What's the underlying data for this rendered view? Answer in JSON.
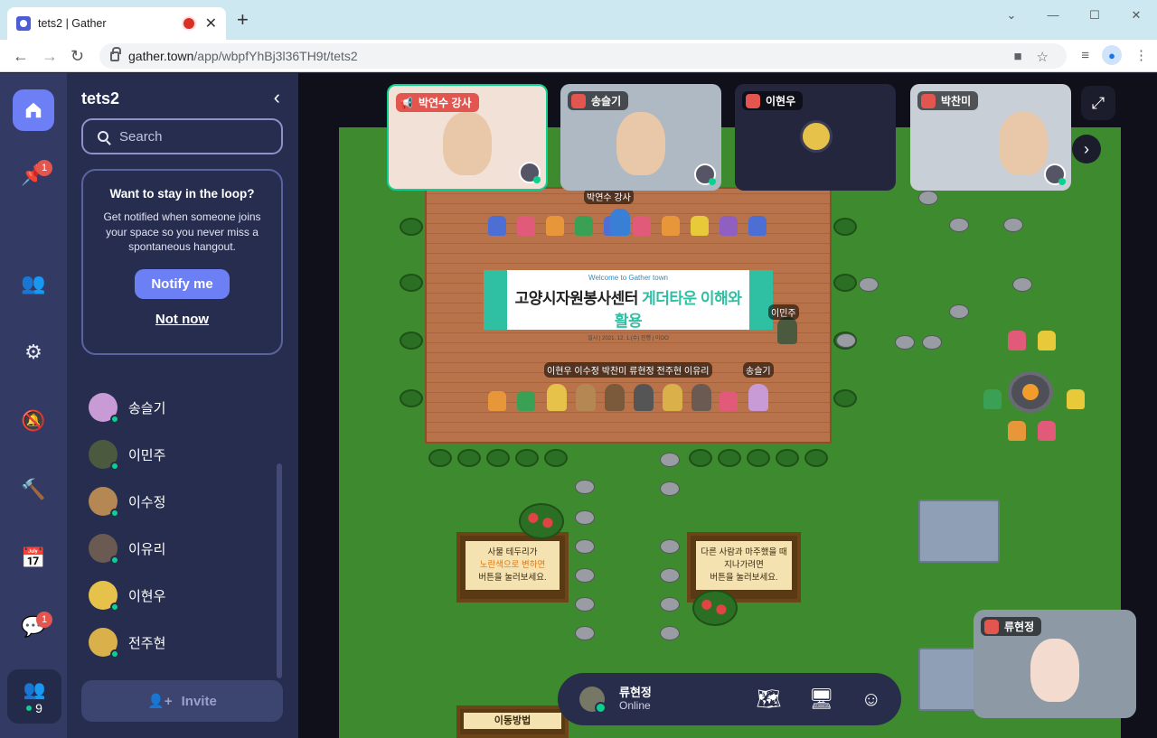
{
  "browser": {
    "tab_title": "tets2 | Gather",
    "tab_close": "✕",
    "new_tab": "+",
    "url_domain": "gather.town",
    "url_path": "/app/wbpfYhBj3l36TH9t/tets2"
  },
  "rail": {
    "notifications_badge": "1",
    "chat_badge": "1",
    "people_count": "9"
  },
  "panel": {
    "space_name": "tets2",
    "search_placeholder": "Search",
    "loop_title": "Want to stay in the loop?",
    "loop_text": "Get notified when someone joins your space so you never miss a spontaneous hangout.",
    "notify_label": "Notify me",
    "not_now_label": "Not now",
    "users": [
      {
        "name": "송슬기",
        "color": "#c89ad6"
      },
      {
        "name": "이민주",
        "color": "#4b5a3e"
      },
      {
        "name": "이수정",
        "color": "#b58752"
      },
      {
        "name": "이유리",
        "color": "#6a5a52"
      },
      {
        "name": "이현우",
        "color": "#e7c24a"
      },
      {
        "name": "전주현",
        "color": "#d9b04a"
      }
    ],
    "invite_label": "Invite"
  },
  "videos": [
    {
      "name": "박연수 강사",
      "speaking": true
    },
    {
      "name": "송슬기",
      "speaking": false
    },
    {
      "name": "이현우",
      "speaking": false
    },
    {
      "name": "박찬미",
      "speaking": false
    }
  ],
  "self_video": {
    "name": "류현정"
  },
  "map": {
    "banner_top": "Welcome to Gather town",
    "banner_title_left": "고양시자원봉사센터",
    "banner_title_right": "게더타운 이해와 활용",
    "banner_date": "일시 | 2021. 12. 1.(수)    진행 | 이OO",
    "tag_instructor": "박연수 강사",
    "tag_minju": "이민주",
    "tag_seulgi": "송슬기",
    "tag_row": "이현우 이수정 박찬미 류현정 전주현 이유리",
    "sign_left_1": "사물 테두리가",
    "sign_left_2": "노란색으로 변하면",
    "sign_left_3": "버튼을 눌러보세요.",
    "sign_right_1": "다른 사람과 마주했을 때",
    "sign_right_2": "지나가려면",
    "sign_right_3": "버튼을 눌러보세요.",
    "sign_bottom": "이동방법"
  },
  "bottombar": {
    "name": "류현정",
    "status": "Online"
  }
}
